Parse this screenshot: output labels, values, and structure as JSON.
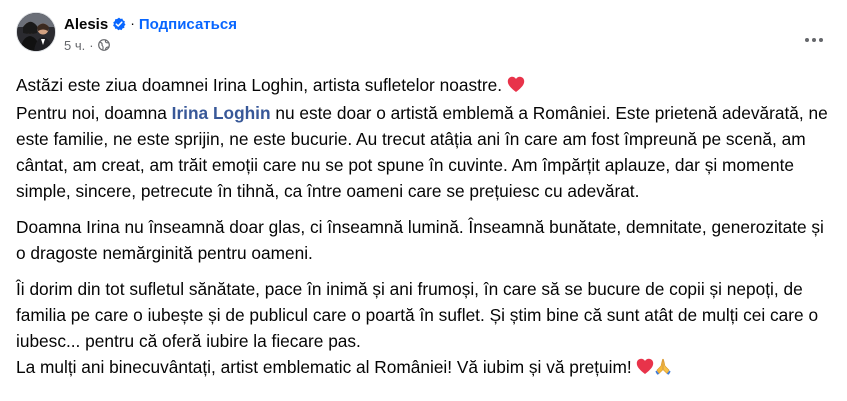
{
  "post": {
    "author": "Alesis",
    "separator": "·",
    "subscribe_label": "Подписаться",
    "time": "5 ч.",
    "time_separator": "·",
    "audience_icon": "globe-icon",
    "more_icon": "more-horizontal-icon",
    "verified_icon": "verified-badge-icon"
  },
  "content": {
    "p1_line1": "Astăzi este ziua doamnei Irina Loghin, artista sufletelor noastre.",
    "p1_emoji": "red-heart-emoji",
    "p1_intro": "Pentru noi, doamna",
    "mention": "Irina Loghin",
    "p1_rest": "nu este doar o artistă emblemă a României. Este prietenă adevărată, ne este familie, ne este sprijin, ne este bucurie. Au trecut atâția ani în care am fost împreună pe scenă, am cântat, am creat, am trăit emoții care nu se pot spune în cuvinte. Am împărțit aplauze, dar și momente simple, sincere, petrecute în tihnă, ca între oameni care se prețuiesc cu adevărat.",
    "p2": "Doamna Irina nu înseamnă doar glas, ci înseamnă lumină. Înseamnă bunătate, demnitate, generozitate și o dragoste nemărginită pentru oameni.",
    "p3": "Îi dorim din tot sufletul sănătate, pace în inimă și ani frumoși, în care să se bucure de copii și nepoți, de familia pe care o iubește și de publicul care o poartă în suflet. Și știm bine că sunt atât de mulți cei care o iubesc... pentru că oferă iubire la fiecare pas.",
    "p4": "La mulți ani binecuvântați, artist emblematic al României! Vă iubim și vă prețuim!",
    "p4_emojis": [
      "red-heart-emoji",
      "folded-hands-emoji"
    ]
  },
  "colors": {
    "link": "#385898",
    "subscribe": "#0866ff",
    "verified": "#0866ff",
    "secondary_text": "#65676b",
    "heart": "#e8334a"
  }
}
